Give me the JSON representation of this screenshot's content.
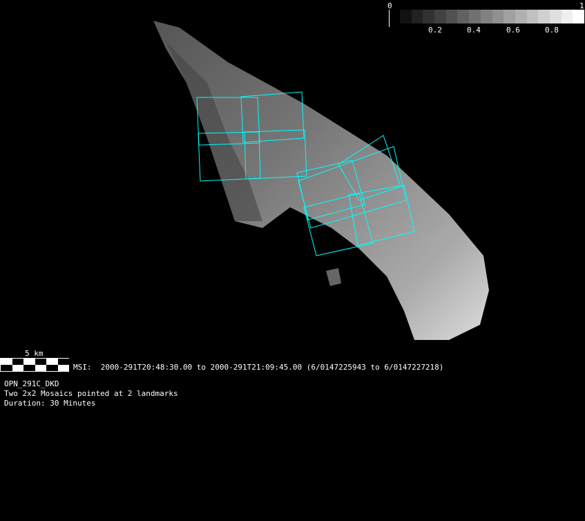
{
  "colorbar": {
    "min_label": "0",
    "max_label": "1",
    "ticks": [
      "0.2",
      "0.4",
      "0.6",
      "0.8"
    ],
    "tick_values": [
      0.2,
      0.4,
      0.6,
      0.8
    ],
    "swatch_count": 16
  },
  "scale_bar": {
    "label": "5 km"
  },
  "info": {
    "msi_line": "MSI:  2000-291T20:48:30.00 to 2000-291T21:09:45.00 (6/0147225943 to 6/0147227218)",
    "id": "OPN_291C_DKD",
    "description": "Two 2x2 Mosaics pointed at 2 landmarks",
    "duration": "Duration: 30 Minutes"
  },
  "colors": {
    "footprint": "#00ffff",
    "background": "#000000"
  }
}
